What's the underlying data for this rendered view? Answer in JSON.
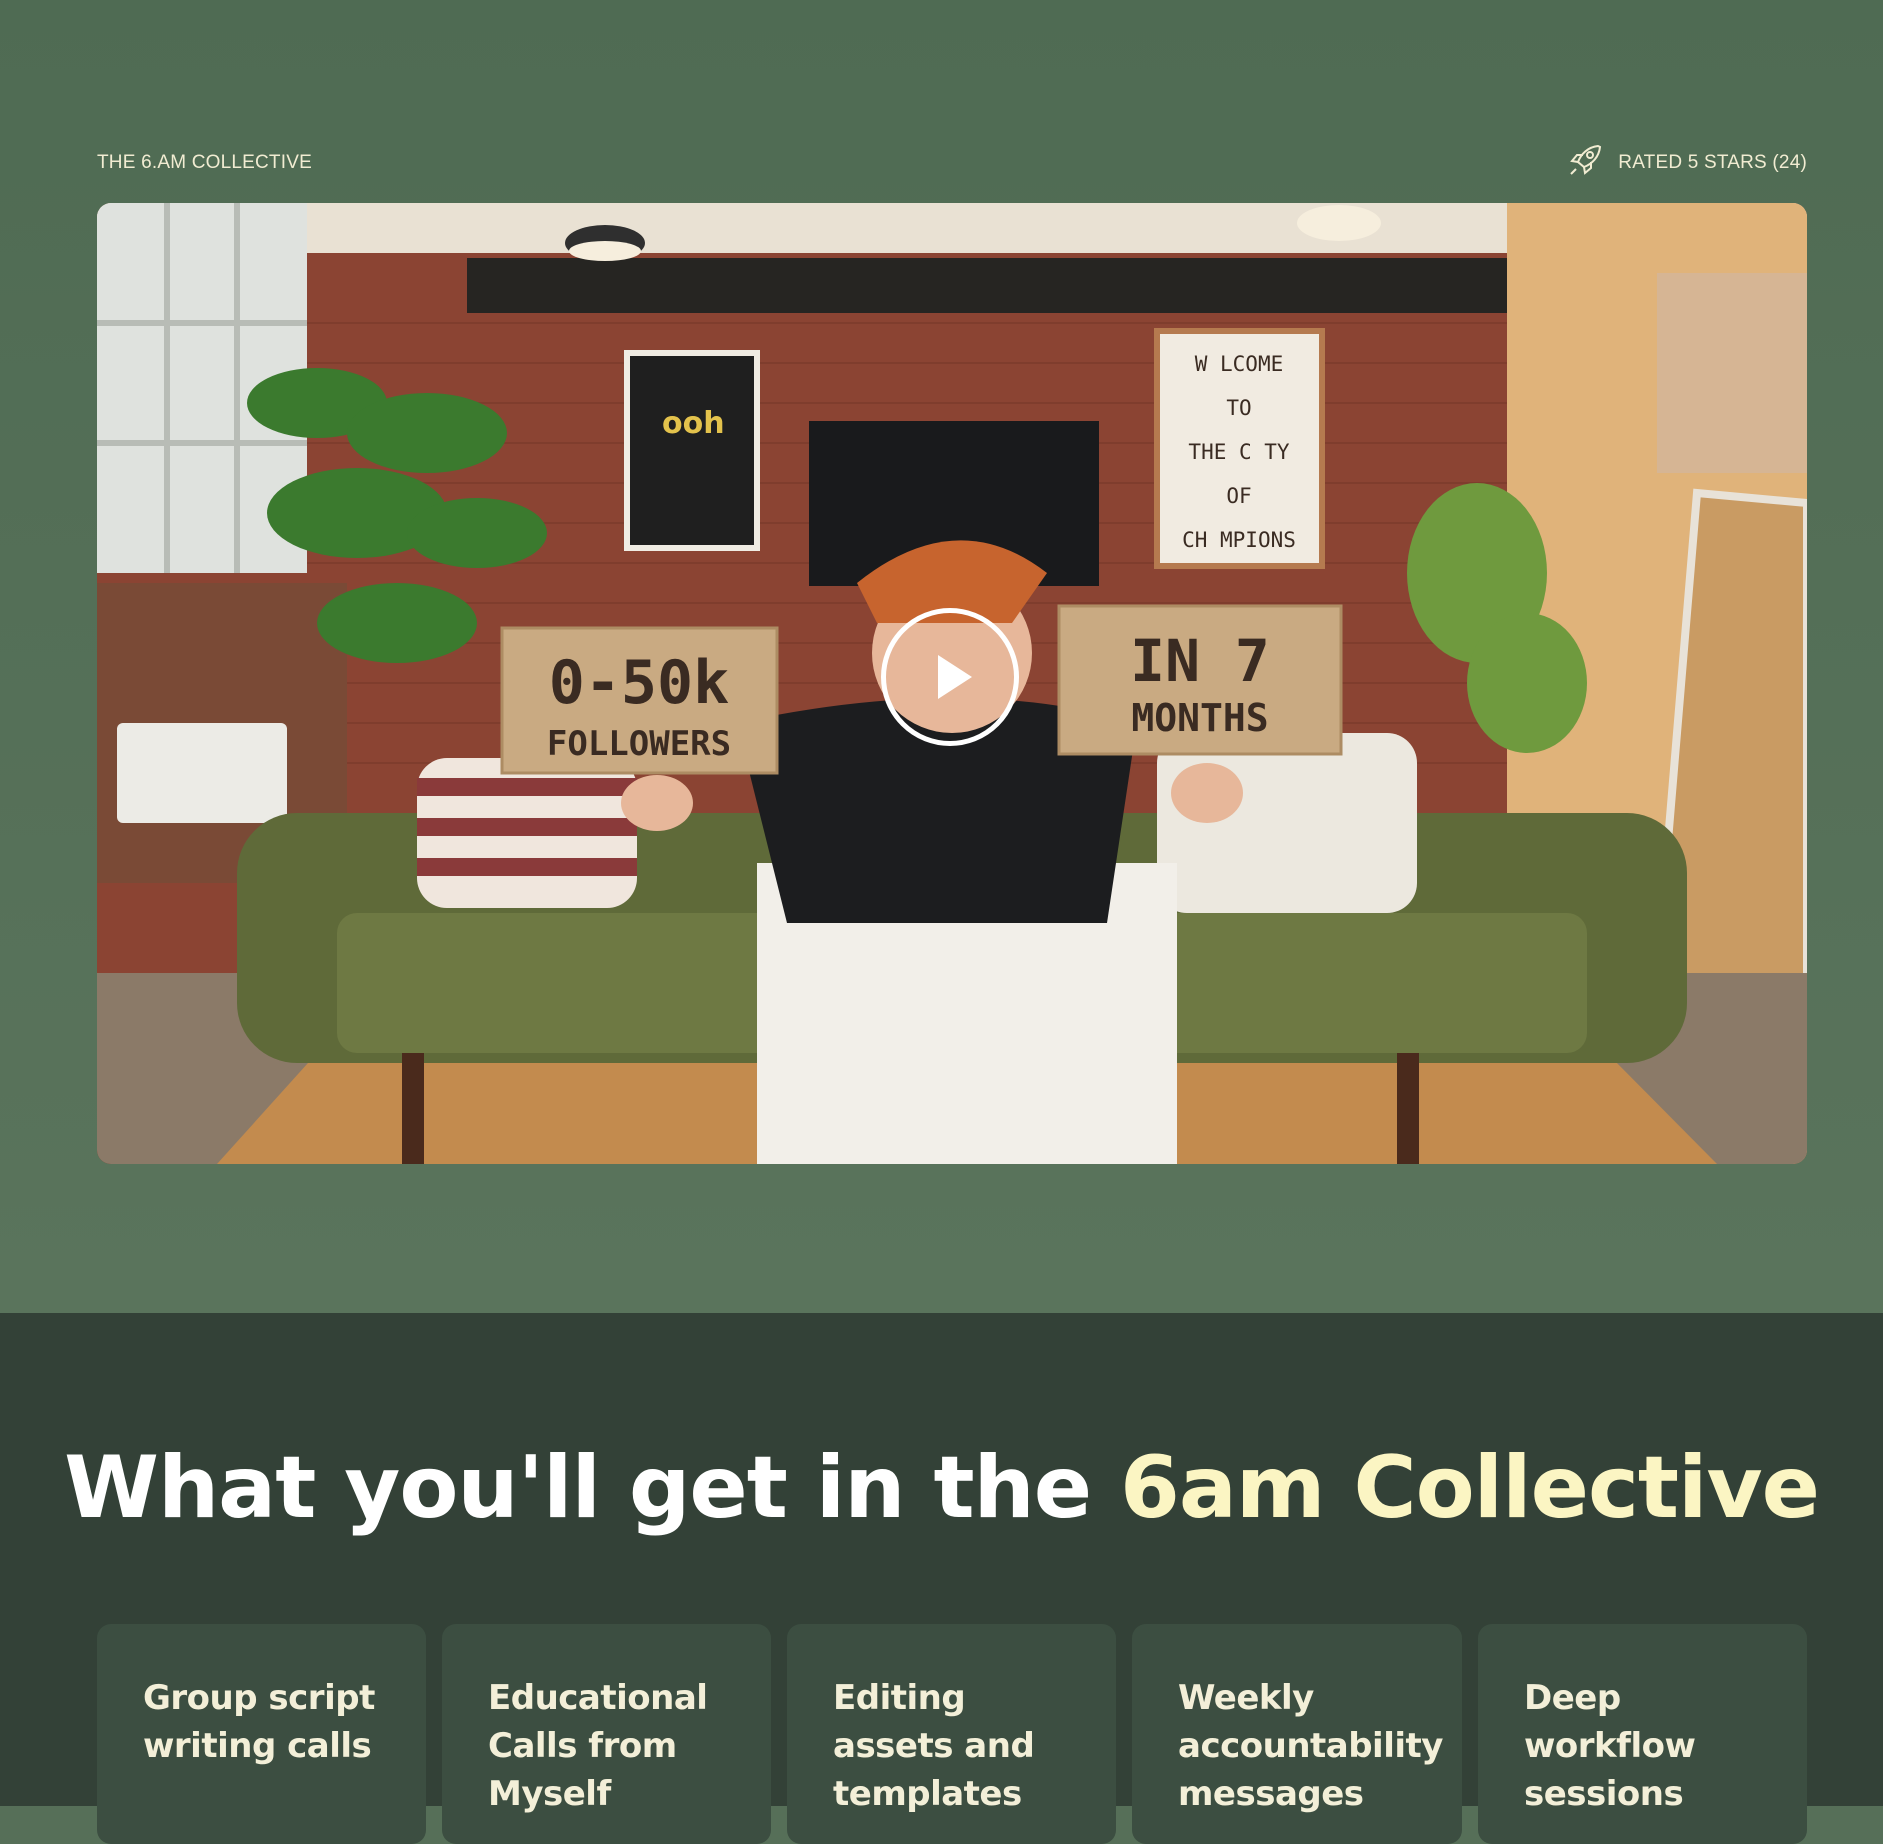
{
  "header": {
    "brand": "THE 6.AM COLLECTIVE",
    "rating_text": "RATED 5 STARS (24)",
    "rating_icon": "rocket-icon"
  },
  "video": {
    "sign_left": [
      "0-50k",
      "FOLLOWERS"
    ],
    "sign_right": [
      "IN 7",
      "MONTHS"
    ],
    "poster_lines": [
      "W LCOME",
      "TO",
      "THE C TY",
      "OF",
      "CH MPIONS"
    ],
    "play_icon": "play-icon"
  },
  "features": {
    "headline_main": "What you'll get in the ",
    "headline_accent": "6am Collective",
    "cards": [
      {
        "title": "Group script writing calls"
      },
      {
        "title": "Educational Calls from Myself"
      },
      {
        "title": "Editing assets and templates"
      },
      {
        "title": "Weekly accountability messages"
      },
      {
        "title": "Deep workflow sessions"
      }
    ]
  },
  "colors": {
    "hero_bg": "#566f58",
    "section_bg": "#334137",
    "card_bg": "#3c4e41",
    "accent": "#fbf5c3"
  }
}
